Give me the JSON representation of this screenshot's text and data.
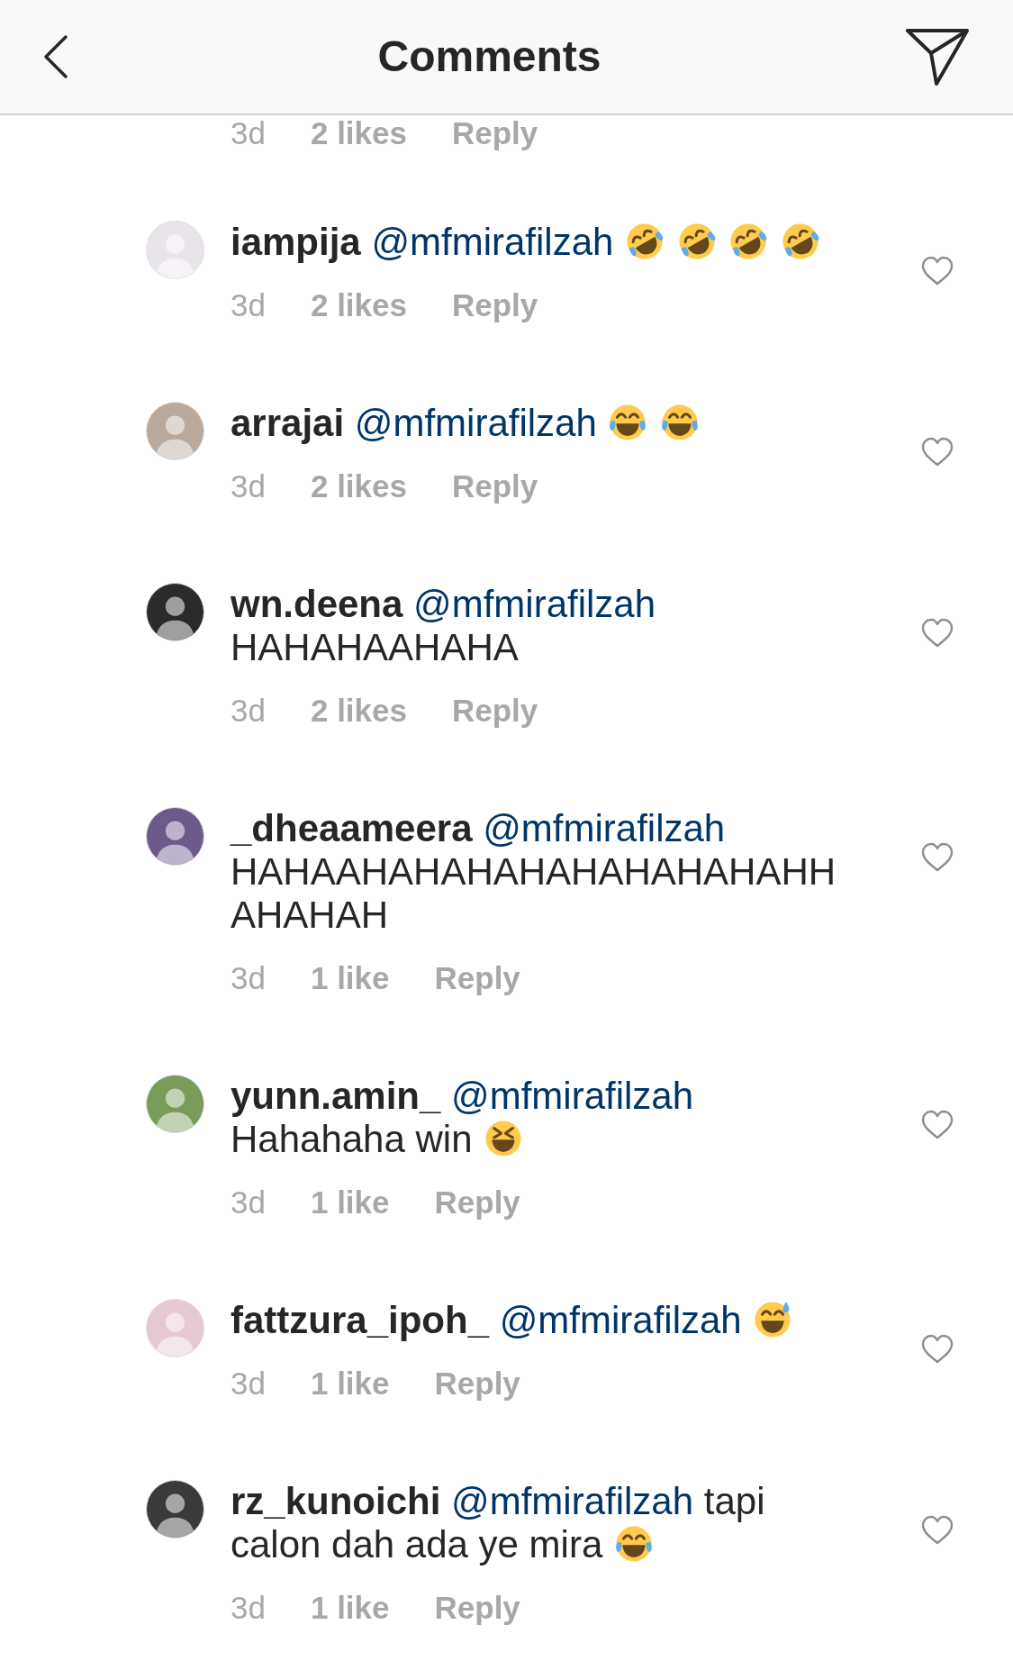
{
  "header": {
    "title": "Comments"
  },
  "partial_comment": {
    "age": "3d",
    "likes": "2 likes",
    "reply": "Reply"
  },
  "comments": [
    {
      "username": "iampija",
      "body": [
        {
          "kind": "mention",
          "text": "@mfmirafilzah"
        },
        {
          "kind": "rofl"
        },
        {
          "kind": "rofl"
        },
        {
          "kind": "rofl"
        },
        {
          "kind": "rofl"
        }
      ],
      "age": "3d",
      "likes": "2 likes",
      "reply": "Reply"
    },
    {
      "username": "arrajai",
      "body": [
        {
          "kind": "mention",
          "text": "@mfmirafilzah"
        },
        {
          "kind": "joy"
        },
        {
          "kind": "joy"
        }
      ],
      "age": "3d",
      "likes": "2 likes",
      "reply": "Reply"
    },
    {
      "username": "wn.deena",
      "body": [
        {
          "kind": "mention",
          "text": "@mfmirafilzah"
        },
        {
          "kind": "text",
          "text": "HAHAHAAHAHA"
        }
      ],
      "age": "3d",
      "likes": "2 likes",
      "reply": "Reply"
    },
    {
      "username": "_dheaameera",
      "body": [
        {
          "kind": "mention",
          "text": "@mfmirafilzah"
        },
        {
          "kind": "text",
          "text": "HAHAAHAHAHAHAHAHAHAHAHHAHAHAH"
        }
      ],
      "age": "3d",
      "likes": "1 like",
      "reply": "Reply"
    },
    {
      "username": "yunn.amin_",
      "body": [
        {
          "kind": "mention",
          "text": "@mfmirafilzah"
        },
        {
          "kind": "text",
          "text": "Hahahaha win"
        },
        {
          "kind": "squint"
        }
      ],
      "age": "3d",
      "likes": "1 like",
      "reply": "Reply"
    },
    {
      "username": "fattzura_ipoh_",
      "body": [
        {
          "kind": "mention",
          "text": "@mfmirafilzah"
        },
        {
          "kind": "sweat"
        }
      ],
      "age": "3d",
      "likes": "1 like",
      "reply": "Reply"
    },
    {
      "username": "rz_kunoichi",
      "body": [
        {
          "kind": "mention",
          "text": "@mfmirafilzah"
        },
        {
          "kind": "text",
          "text": "tapi calon dah ada ye mira"
        },
        {
          "kind": "joy"
        }
      ],
      "age": "3d",
      "likes": "1 like",
      "reply": "Reply"
    }
  ]
}
